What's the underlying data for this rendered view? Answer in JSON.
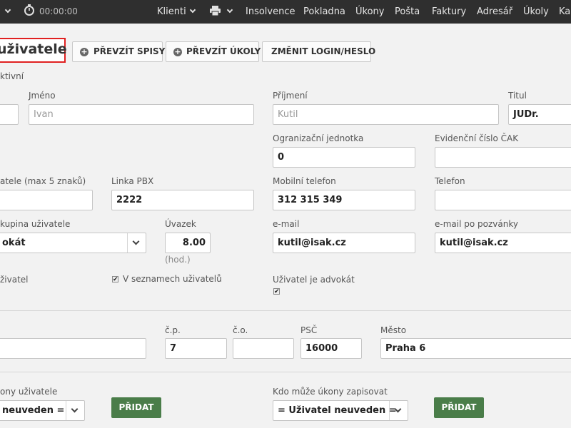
{
  "topbar": {
    "timer": "00:00:00",
    "menu": [
      "Klienti",
      "Insolvence",
      "Pokladna",
      "Úkony",
      "Pošta",
      "Faktury",
      "Adresář",
      "Úkoly",
      "Ka"
    ]
  },
  "heading": {
    "title": "uživatele"
  },
  "toolbar": {
    "btn_prevzit_spisy": "PŘEVZÍT SPISY",
    "btn_prevzit_ukoly": "PŘEVZÍT ÚKOLY",
    "btn_zmenit_login": "ZMĚNIT LOGIN/HESLO"
  },
  "status": {
    "aktivni": "ktivní"
  },
  "form": {
    "jmeno": {
      "label": "Jméno",
      "value": "Ivan"
    },
    "prijmeni": {
      "label": "Příjmení",
      "value": "Kutil"
    },
    "titul": {
      "label": "Titul",
      "value": "JUDr."
    },
    "org_jednotka": {
      "label": "Ogranizační jednotka",
      "value": "0"
    },
    "evidencni_cislo": {
      "label": "Evidenční číslo ČAK",
      "value": ""
    },
    "zkratka": {
      "label": "atele (max 5 znaků)",
      "value": ""
    },
    "linka_pbx": {
      "label": "Linka PBX",
      "value": "2222"
    },
    "mobilni_telefon": {
      "label": "Mobilní telefon",
      "value": "312 315 349"
    },
    "telefon": {
      "label": "Telefon",
      "value": ""
    },
    "skupina": {
      "label": "kupina uživatele",
      "value": "okát"
    },
    "uvazek": {
      "label": "Úvazek",
      "value": "8.00",
      "unit": "(hod.)"
    },
    "email": {
      "label": "e-mail",
      "value": "kutil@isak.cz"
    },
    "email_pozvanky": {
      "label": "e-mail po pozvánky",
      "value": "kutil@isak.cz"
    },
    "uzivatel_flag": {
      "label": "živatel"
    },
    "v_seznamech": {
      "label": "V seznamech uživatelů",
      "checked": true
    },
    "advokat": {
      "label": "Uživatel je advokát",
      "checked": true
    }
  },
  "address": {
    "ulice": {
      "value": ""
    },
    "cp": {
      "label": "č.p.",
      "value": "7"
    },
    "co": {
      "label": "č.o.",
      "value": ""
    },
    "psc": {
      "label": "PSČ",
      "value": "16000"
    },
    "mesto": {
      "label": "Město",
      "value": "Praha 6"
    }
  },
  "ukony": {
    "left": {
      "label": "ony uživatele",
      "value": "neuveden =",
      "button": "PŘIDAT"
    },
    "right": {
      "label": "Kdo může úkony zapisovat",
      "value": "= Uživatel neuveden =",
      "button": "PŘIDAT"
    }
  },
  "colors": {
    "topbar": "#2f2f2f",
    "accent_green": "#4a7d49",
    "highlight_red": "#e02020"
  }
}
